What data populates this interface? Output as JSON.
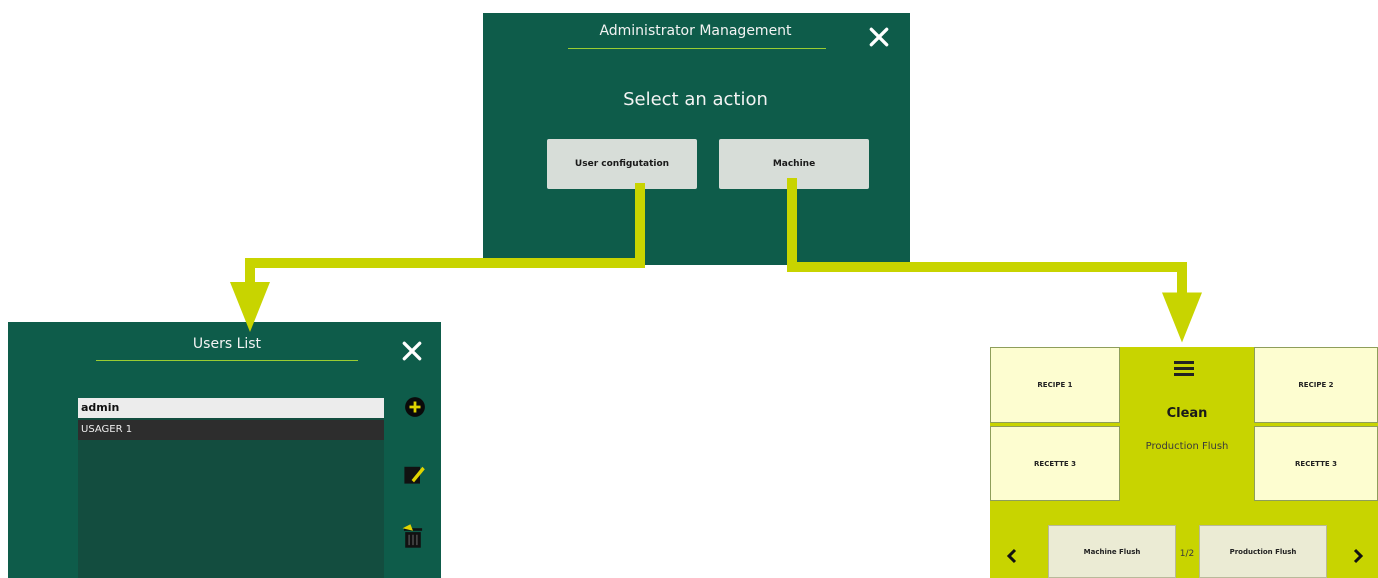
{
  "admin_panel": {
    "title": "Administrator Management",
    "subtitle": "Select an action",
    "buttons": [
      "User configutation",
      "Machine"
    ]
  },
  "users_panel": {
    "title": "Users List",
    "users": [
      "admin",
      "USAGER 1"
    ]
  },
  "machine_panel": {
    "tiles": [
      "RECIPE 1",
      "RECIPE 2",
      "RECETTE 3",
      "RECETTE 3"
    ],
    "center_title": "Clean",
    "center_subtitle": "Production Flush",
    "bottom_buttons": [
      "Machine Flush",
      "Production Flush"
    ],
    "page_indicator": "1/2"
  },
  "colors": {
    "panel_bg": "#0e5c4a",
    "accent": "#c8d400",
    "tile_bg": "#fdfdd0"
  },
  "icons": [
    "close-icon",
    "add-icon",
    "edit-icon",
    "trash-icon",
    "menu-icon",
    "chevron-left-icon",
    "chevron-right-icon"
  ]
}
